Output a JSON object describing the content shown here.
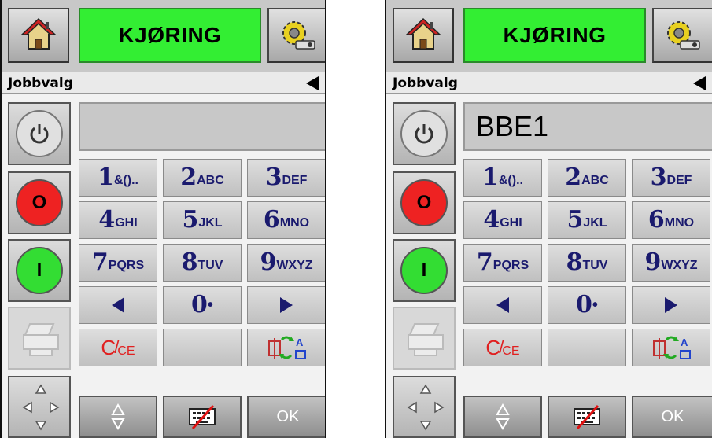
{
  "panels": [
    {
      "status_label": "KJØRING",
      "menu_title": "Jobbvalg",
      "display_value": "",
      "side": {
        "stop_label": "O",
        "start_label": "I"
      },
      "keypad": {
        "k1": {
          "digit": "1",
          "letters": "&()..",
          "label": "1&().."
        },
        "k2": {
          "digit": "2",
          "letters": "ABC"
        },
        "k3": {
          "digit": "3",
          "letters": "DEF"
        },
        "k4": {
          "digit": "4",
          "letters": "GHI"
        },
        "k5": {
          "digit": "5",
          "letters": "JKL"
        },
        "k6": {
          "digit": "6",
          "letters": "MNO"
        },
        "k7": {
          "digit": "7",
          "letters": "PQRS"
        },
        "k8": {
          "digit": "8",
          "letters": "TUV"
        },
        "k9": {
          "digit": "9",
          "letters": "WXYZ"
        },
        "k0": {
          "digit": "0",
          "letters": "•"
        },
        "clear": {
          "c": "C",
          "ce": "CE"
        }
      },
      "ok_label": "OK"
    },
    {
      "status_label": "KJØRING",
      "menu_title": "Jobbvalg",
      "display_value": "BBE1",
      "side": {
        "stop_label": "O",
        "start_label": "I"
      },
      "keypad": {
        "k1": {
          "digit": "1",
          "letters": "&().."
        },
        "k2": {
          "digit": "2",
          "letters": "ABC"
        },
        "k3": {
          "digit": "3",
          "letters": "DEF"
        },
        "k4": {
          "digit": "4",
          "letters": "GHI"
        },
        "k5": {
          "digit": "5",
          "letters": "JKL"
        },
        "k6": {
          "digit": "6",
          "letters": "MNO"
        },
        "k7": {
          "digit": "7",
          "letters": "PQRS"
        },
        "k8": {
          "digit": "8",
          "letters": "TUV"
        },
        "k9": {
          "digit": "9",
          "letters": "WXYZ"
        },
        "k0": {
          "digit": "0",
          "letters": "•"
        },
        "clear": {
          "c": "C",
          "ce": "CE"
        }
      },
      "ok_label": "OK"
    }
  ],
  "colors": {
    "status_green": "#33ee33",
    "stop_red": "#ee2222",
    "start_green": "#33dd33",
    "key_text": "#1a1a6e",
    "clear_red": "#e02020"
  },
  "icons": [
    "home-icon",
    "settings-gear-icon",
    "power-icon",
    "print-icon",
    "navigate-arrows-icon",
    "back-arrow-icon",
    "left-arrow-icon",
    "right-arrow-icon",
    "up-down-arrows-icon",
    "keyboard-disabled-icon",
    "character-set-switch-icon"
  ]
}
